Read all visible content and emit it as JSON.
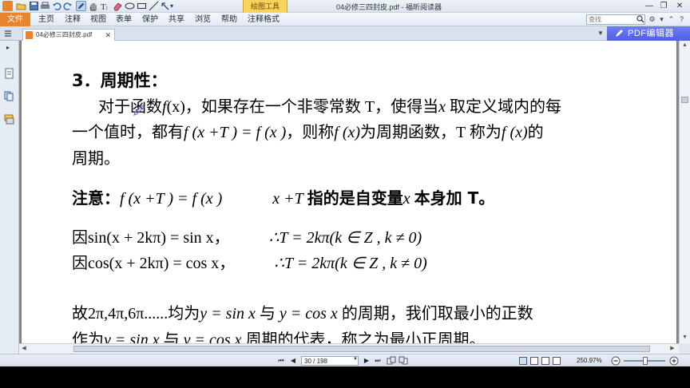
{
  "window": {
    "title": "04必修三四封皮.pdf - 福昕阅读器",
    "context_tab": "绘图工具",
    "controls": {
      "minimize": "—",
      "restore": "❐",
      "close": "✕"
    }
  },
  "menu": {
    "file": "文件",
    "items": [
      "主页",
      "注释",
      "视图",
      "表单",
      "保护",
      "共享",
      "浏览",
      "帮助",
      "注释格式"
    ]
  },
  "search": {
    "placeholder": "查找"
  },
  "tab": {
    "label": "04必修三四封皮.pdf",
    "close": "✕"
  },
  "pdf_editor": {
    "label": "PDF编辑器"
  },
  "document": {
    "heading": "3．周期性：",
    "p1_a": "对于函数",
    "p1_f": "f",
    "p1_x": "(x)",
    "p1_b": "，如果存在一个非零常数 T，使得当",
    "p1_xv": "x",
    "p1_c": "取定义域内的每",
    "p2_a": "一个值时，都有",
    "p2_eq": "f (x +T ) = f (x )",
    "p2_b": "，则称",
    "p2_fx": "f (x)",
    "p2_c": "为周期函数，T 称为",
    "p2_fx2": "f (x)",
    "p2_d": "的",
    "p3": "周期。",
    "note_label": "注意：",
    "note_eq": "f (x +T ) = f (x )",
    "note_xt": "x +T",
    "note_text": "指的是自变量",
    "note_x": "x",
    "note_end": "本身加 T。",
    "sin_a": "因",
    "sin_eq": "sin(x + 2kπ) = sin x",
    "sin_comma": "，",
    "sin_t": "∴T  = 2kπ(k ∈ Z , k ≠ 0)",
    "cos_a": "因",
    "cos_eq": "cos(x + 2kπ) = cos x",
    "cos_comma": "，",
    "cos_t": "∴T  = 2kπ(k ∈ Z , k ≠ 0)",
    "gu_a": "故",
    "gu_vals": "2π,4π,6π......",
    "gu_b": "均为",
    "gu_y1": "y = sin x",
    "gu_c": "与",
    "gu_y2": "y = cos x",
    "gu_d": "的周期，我们取最小的正数",
    "zw_a": "作为",
    "zw_y1": "y = sin x",
    "zw_b": "与",
    "zw_y2": "y = cos x",
    "zw_c": "周期的代表，称之为最小正周期。"
  },
  "status": {
    "page": "30 / 198",
    "zoom": "250.97%"
  },
  "colors": {
    "file_menu": "#e8832e",
    "context_tab": "#f7d25c",
    "pdf_editor": "#5a6ae8"
  }
}
